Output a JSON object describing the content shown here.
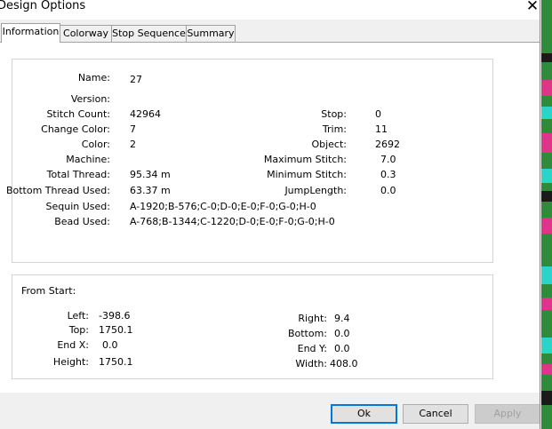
{
  "window": {
    "title": "Design Options"
  },
  "tabs": [
    {
      "label": "Information"
    },
    {
      "label": "Colorway"
    },
    {
      "label": "Stop Sequence"
    },
    {
      "label": "Summary"
    }
  ],
  "info": {
    "name_label": "Name:",
    "name": "27",
    "version_label": "Version:",
    "version": "",
    "stitch_count_label": "Stitch Count:",
    "stitch_count": "42964",
    "change_color_label": "Change Color:",
    "change_color": "7",
    "color_label": "Color:",
    "color": "2",
    "machine_label": "Machine:",
    "machine": "",
    "total_thread_label": "Total Thread:",
    "total_thread": "95.34 m",
    "bottom_thread_label": "Bottom Thread Used:",
    "bottom_thread": "63.37 m",
    "sequin_label": "Sequin Used:",
    "sequin": "A-1920;B-576;C-0;D-0;E-0;F-0;G-0;H-0",
    "bead_label": "Bead Used:",
    "bead": "A-768;B-1344;C-1220;D-0;E-0;F-0;G-0;H-0",
    "stop_label": "Stop:",
    "stop": "0",
    "trim_label": "Trim:",
    "trim": "11",
    "object_label": "Object:",
    "object": "2692",
    "max_stitch_label": "Maximum Stitch:",
    "max_stitch": "7.0",
    "min_stitch_label": "Minimum Stitch:",
    "min_stitch": "0.3",
    "jump_length_label": "JumpLength:",
    "jump_length": "0.0"
  },
  "from_start": {
    "heading": "From Start:",
    "left_label": "Left:",
    "left": "-398.6",
    "top_label": "Top:",
    "top": "1750.1",
    "end_x_label": "End X:",
    "end_x": "0.0",
    "height_label": "Height:",
    "height": "1750.1",
    "right_label": "Right:",
    "right": "9.4",
    "bottom_label": "Bottom:",
    "bottom": "0.0",
    "end_y_label": "End Y:",
    "end_y": "0.0",
    "width_label": "Width:",
    "width": "408.0"
  },
  "buttons": {
    "ok": "Ok",
    "cancel": "Cancel",
    "apply": "Apply"
  }
}
